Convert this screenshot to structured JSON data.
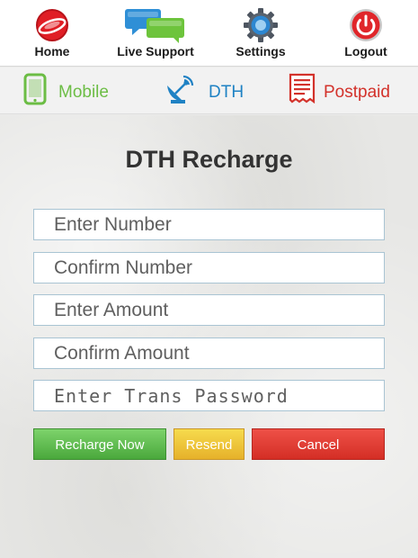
{
  "topnav": [
    {
      "label": "Home",
      "icon": "home-logo-icon"
    },
    {
      "label": "Live Support",
      "icon": "chat-bubbles-icon"
    },
    {
      "label": "Settings",
      "icon": "gear-icon"
    },
    {
      "label": "Logout",
      "icon": "power-icon"
    }
  ],
  "tabs": [
    {
      "label": "Mobile",
      "icon": "mobile-phone-icon",
      "color": "#6cbd45"
    },
    {
      "label": "DTH",
      "icon": "satellite-dish-icon",
      "color": "#1f82c4"
    },
    {
      "label": "Postpaid",
      "icon": "bill-document-icon",
      "color": "#d3322b"
    }
  ],
  "page_title": "DTH Recharge",
  "form": {
    "enter_number_placeholder": "Enter Number",
    "confirm_number_placeholder": "Confirm Number",
    "enter_amount_placeholder": "Enter Amount",
    "confirm_amount_placeholder": "Confirm Amount",
    "trans_password_placeholder": "Enter Trans Password"
  },
  "buttons": {
    "recharge_label": "Recharge Now",
    "resend_label": "Resend",
    "cancel_label": "Cancel"
  }
}
